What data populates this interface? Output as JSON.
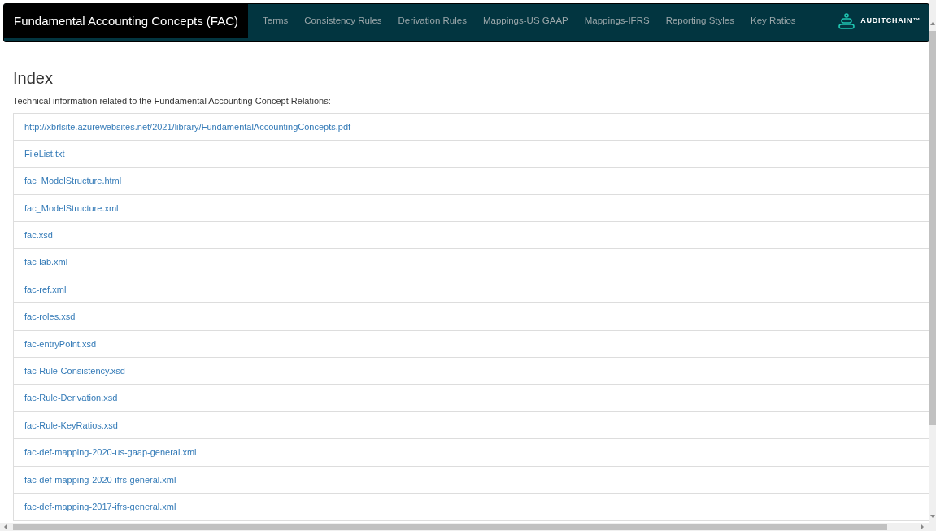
{
  "navbar": {
    "brand": "Fundamental Accounting Concepts (FAC)",
    "links": [
      {
        "label": "Terms"
      },
      {
        "label": "Consistency Rules"
      },
      {
        "label": "Derivation Rules"
      },
      {
        "label": "Mappings-US GAAP"
      },
      {
        "label": "Mappings-IFRS"
      },
      {
        "label": "Reporting Styles"
      },
      {
        "label": "Key Ratios"
      }
    ],
    "logo_text": "AUDITCHAIN™"
  },
  "heading": "Index",
  "intro": "Technical information related to the Fundamental Accounting Concept Relations:",
  "files": [
    {
      "label": "http://xbrlsite.azurewebsites.net/2021/library/FundamentalAccountingConcepts.pdf"
    },
    {
      "label": "FileList.txt"
    },
    {
      "label": "fac_ModelStructure.html"
    },
    {
      "label": "fac_ModelStructure.xml"
    },
    {
      "label": "fac.xsd"
    },
    {
      "label": "fac-lab.xml"
    },
    {
      "label": "fac-ref.xml"
    },
    {
      "label": "fac-roles.xsd"
    },
    {
      "label": "fac-entryPoint.xsd"
    },
    {
      "label": "fac-Rule-Consistency.xsd"
    },
    {
      "label": "fac-Rule-Derivation.xsd"
    },
    {
      "label": "fac-Rule-KeyRatios.xsd"
    },
    {
      "label": "fac-def-mapping-2020-us-gaap-general.xml"
    },
    {
      "label": "fac-def-mapping-2020-ifrs-general.xml"
    },
    {
      "label": "fac-def-mapping-2017-ifrs-general.xml"
    }
  ]
}
